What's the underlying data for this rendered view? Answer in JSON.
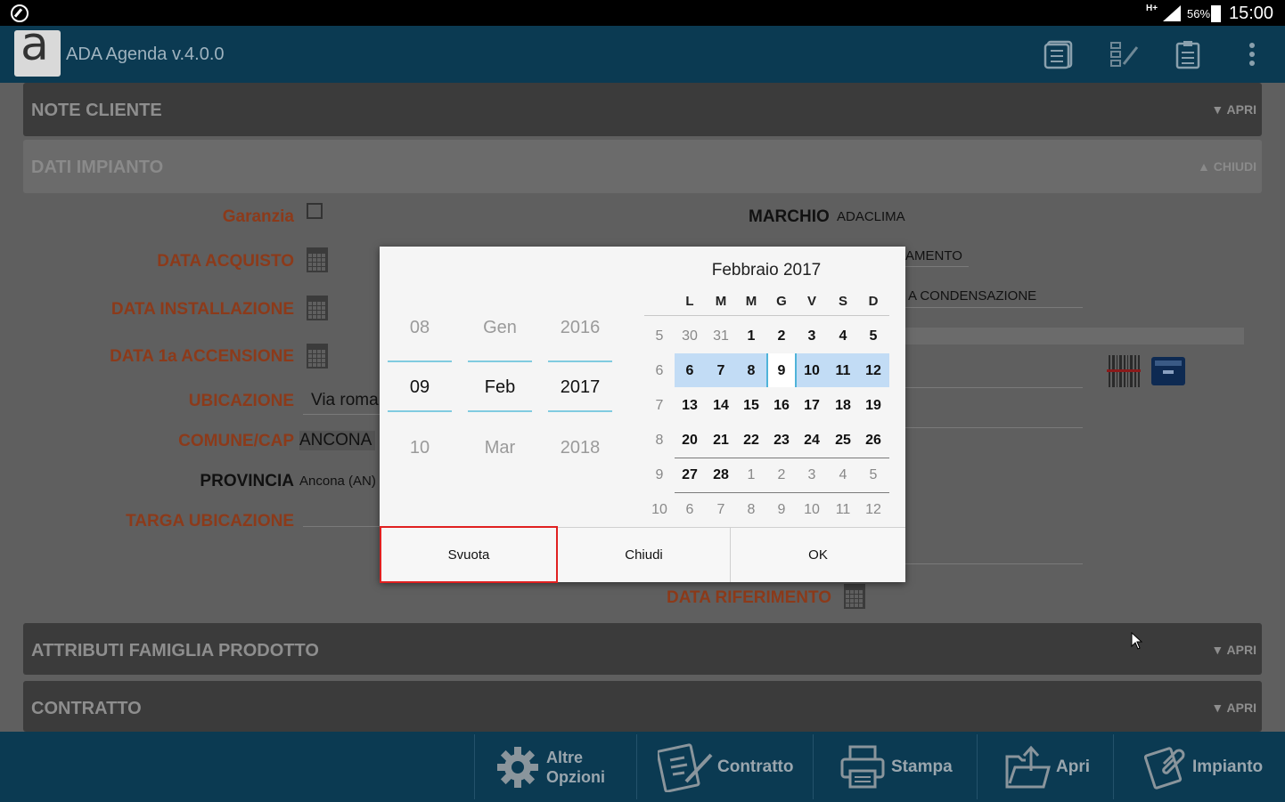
{
  "statusbar": {
    "network": "H+",
    "battery": "56%",
    "time": "15:00"
  },
  "appbar": {
    "title": "ADA Agenda v.4.0.0",
    "icons": [
      "document-list-icon",
      "edit-list-icon",
      "clipboard-icon",
      "overflow-menu-icon"
    ]
  },
  "sections": {
    "note_cliente": {
      "title": "NOTE CLIENTE",
      "toggle": "APRI"
    },
    "dati_impianto": {
      "title": "DATI IMPIANTO",
      "toggle": "CHIUDI"
    },
    "attributi": {
      "title": "ATTRIBUTI FAMIGLIA PRODOTTO",
      "toggle": "APRI"
    },
    "contratto": {
      "title": "CONTRATTO",
      "toggle": "APRI"
    }
  },
  "form": {
    "garanzia": "Garanzia",
    "data_acquisto": "DATA ACQUISTO",
    "data_installazione": "DATA INSTALLAZIONE",
    "data_accensione": "DATA 1a ACCENSIONE",
    "ubicazione": "UBICAZIONE",
    "ubicazione_value": "Via roma",
    "comune": "COMUNE/CAP",
    "comune_value": "ANCONA",
    "provincia": "PROVINCIA",
    "provincia_value": "Ancona (AN)",
    "targa": "TARGA UBICAZIONE",
    "marchio": "MARCHIO",
    "marchio_value": "ADACLIMA",
    "partial_1": "AMENTO",
    "partial_2": "A CONDENSAZIONE",
    "data_riferimento": "DATA RIFERIMENTO"
  },
  "dialog": {
    "picker": {
      "day": {
        "prev": "08",
        "selected": "09",
        "next": "10"
      },
      "month": {
        "prev": "Gen",
        "selected": "Feb",
        "next": "Mar"
      },
      "year": {
        "prev": "2016",
        "selected": "2017",
        "next": "2018"
      }
    },
    "calendar": {
      "title": "Febbraio 2017",
      "weekdays": [
        "L",
        "M",
        "M",
        "G",
        "V",
        "S",
        "D"
      ],
      "weeks": [
        {
          "num": "5",
          "days": [
            "30",
            "31",
            "1",
            "2",
            "3",
            "4",
            "5"
          ]
        },
        {
          "num": "6",
          "days": [
            "6",
            "7",
            "8",
            "9",
            "10",
            "11",
            "12"
          ]
        },
        {
          "num": "7",
          "days": [
            "13",
            "14",
            "15",
            "16",
            "17",
            "18",
            "19"
          ]
        },
        {
          "num": "8",
          "days": [
            "20",
            "21",
            "22",
            "23",
            "24",
            "25",
            "26"
          ]
        },
        {
          "num": "9",
          "days": [
            "27",
            "28",
            "1",
            "2",
            "3",
            "4",
            "5"
          ]
        },
        {
          "num": "10",
          "days": [
            "6",
            "7",
            "8",
            "9",
            "10",
            "11",
            "12"
          ]
        }
      ],
      "selected_week": "6",
      "selected_day": "9"
    },
    "buttons": {
      "clear": "Svuota",
      "close": "Chiudi",
      "ok": "OK"
    }
  },
  "bottombar": {
    "altre_opzioni_1": "Altre",
    "altre_opzioni_2": "Opzioni",
    "contratto": "Contratto",
    "stampa": "Stampa",
    "apri": "Apri",
    "impianto": "Impianto"
  },
  "colors": {
    "appbar": "#0b3a52",
    "label": "#8c3a1a",
    "selection": "#c2dcf5",
    "highlight_border": "#e02020"
  }
}
